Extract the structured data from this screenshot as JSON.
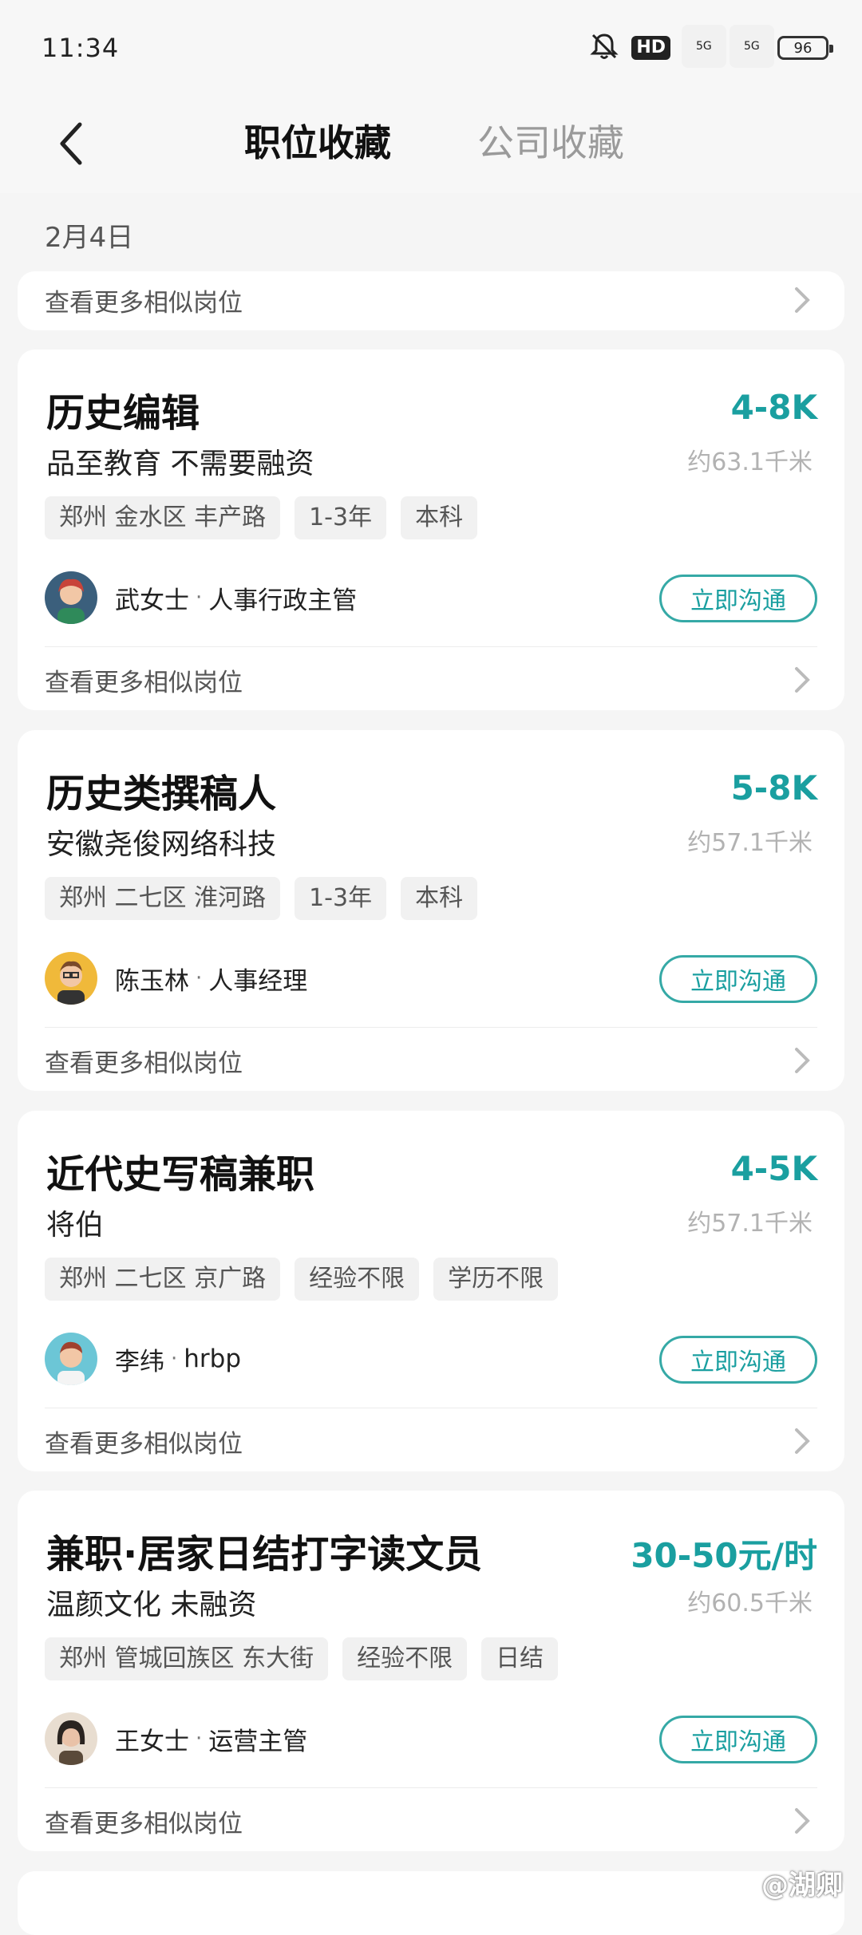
{
  "status": {
    "time": "11:34",
    "hd": "HD",
    "net1": "5G",
    "net2": "5G",
    "battery": "96"
  },
  "nav": {
    "tab_active": "职位收藏",
    "tab_inactive": "公司收藏",
    "back_icon": "chevron-left-icon"
  },
  "date": "2月4日",
  "more_label": "查看更多相似岗位",
  "chat_label": "立即沟通",
  "jobs": [
    {
      "title": "历史编辑",
      "salary": "4-8K",
      "company": "品至教育 不需要融资",
      "distance": "约63.1千米",
      "tags": [
        "郑州 金水区 丰产路",
        "1-3年",
        "本科"
      ],
      "recruiter_name": "武女士",
      "recruiter_role": "人事行政主管"
    },
    {
      "title": "历史类撰稿人",
      "salary": "5-8K",
      "company": "安徽尧俊网络科技",
      "distance": "约57.1千米",
      "tags": [
        "郑州 二七区 淮河路",
        "1-3年",
        "本科"
      ],
      "recruiter_name": "陈玉林",
      "recruiter_role": "人事经理"
    },
    {
      "title": "近代史写稿兼职",
      "salary": "4-5K",
      "company": "将伯",
      "distance": "约57.1千米",
      "tags": [
        "郑州 二七区 京广路",
        "经验不限",
        "学历不限"
      ],
      "recruiter_name": "李纬",
      "recruiter_role": "hrbp"
    },
    {
      "title": "兼职·居家日结打字读文员",
      "salary": "30-50元/时",
      "company": "温颜文化 未融资",
      "distance": "约60.5千米",
      "tags": [
        "郑州 管城回族区 东大街",
        "经验不限",
        "日结"
      ],
      "recruiter_name": "王女士",
      "recruiter_role": "运营主管"
    }
  ],
  "watermark": "@湖卿",
  "colors": {
    "accent": "#1a9fa0",
    "background": "#f5f5f5"
  }
}
